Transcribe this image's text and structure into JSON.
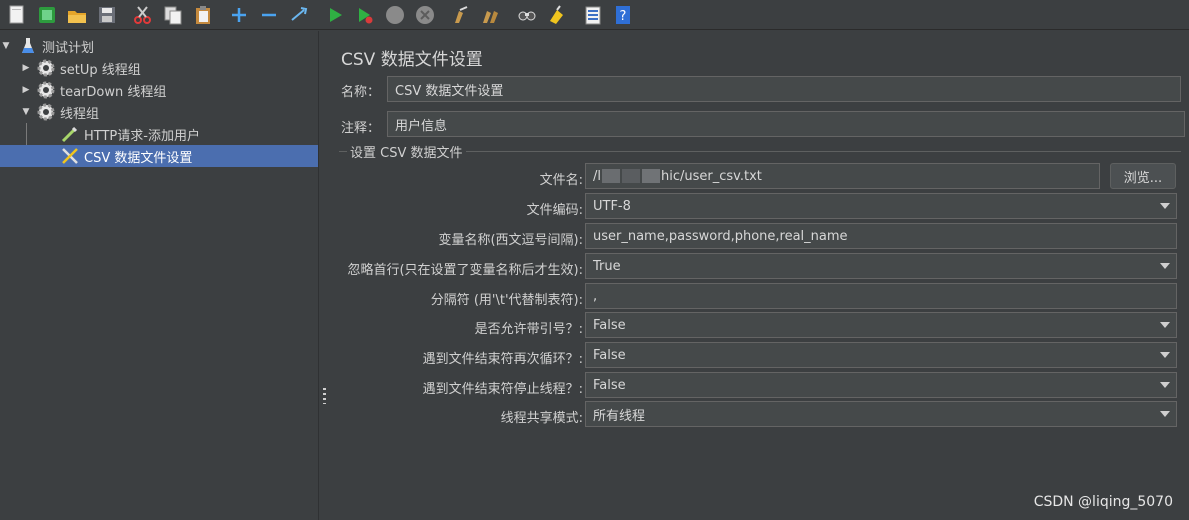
{
  "toolbar": {
    "icons": [
      "new-icon",
      "templates-icon",
      "open-icon",
      "save-icon",
      "cut-icon",
      "copy-icon",
      "paste-icon",
      "expand-icon",
      "collapse-icon",
      "toggle-icon",
      "start-icon",
      "start-no-pause-icon",
      "stop-icon",
      "shutdown-icon",
      "clear-icon",
      "clear-all-icon",
      "search-icon",
      "reset-search-icon",
      "function-helper-icon",
      "help-icon"
    ]
  },
  "tree": {
    "items": [
      {
        "label": "测试计划",
        "icon": "test-plan-icon"
      },
      {
        "label": "setUp 线程组",
        "icon": "gear-icon"
      },
      {
        "label": "tearDown 线程组",
        "icon": "gear-icon"
      },
      {
        "label": "线程组",
        "icon": "gear-icon"
      },
      {
        "label": "HTTP请求-添加用户",
        "icon": "pipette-icon"
      },
      {
        "label": "CSV 数据文件设置",
        "icon": "tools-icon"
      }
    ]
  },
  "panel": {
    "title": "CSV 数据文件设置",
    "name_label": "名称：",
    "name_value": "CSV 数据文件设置",
    "comment_label": "注释：",
    "comment_value": "用户信息",
    "section_title": "设置 CSV 数据文件",
    "filename_label": "文件名:",
    "filename_prefix": "/l",
    "filename_suffix": "hic/user_csv.txt",
    "browse_label": "浏览...",
    "encoding_label": "文件编码:",
    "encoding_value": "UTF-8",
    "varnames_label": "变量名称(西文逗号间隔):",
    "varnames_value": "user_name,password,phone,real_name",
    "ignore_first_label": "忽略首行(只在设置了变量名称后才生效):",
    "ignore_first_value": "True",
    "delimiter_label": "分隔符 (用'\\t'代替制表符):",
    "delimiter_value": ",",
    "quoted_label": "是否允许带引号？:",
    "quoted_value": "False",
    "recycle_label": "遇到文件结束符再次循环？:",
    "recycle_value": "False",
    "stop_label": "遇到文件结束符停止线程？:",
    "stop_value": "False",
    "sharing_label": "线程共享模式:",
    "sharing_value": "所有线程"
  },
  "watermark": "CSDN @liqing_5070"
}
